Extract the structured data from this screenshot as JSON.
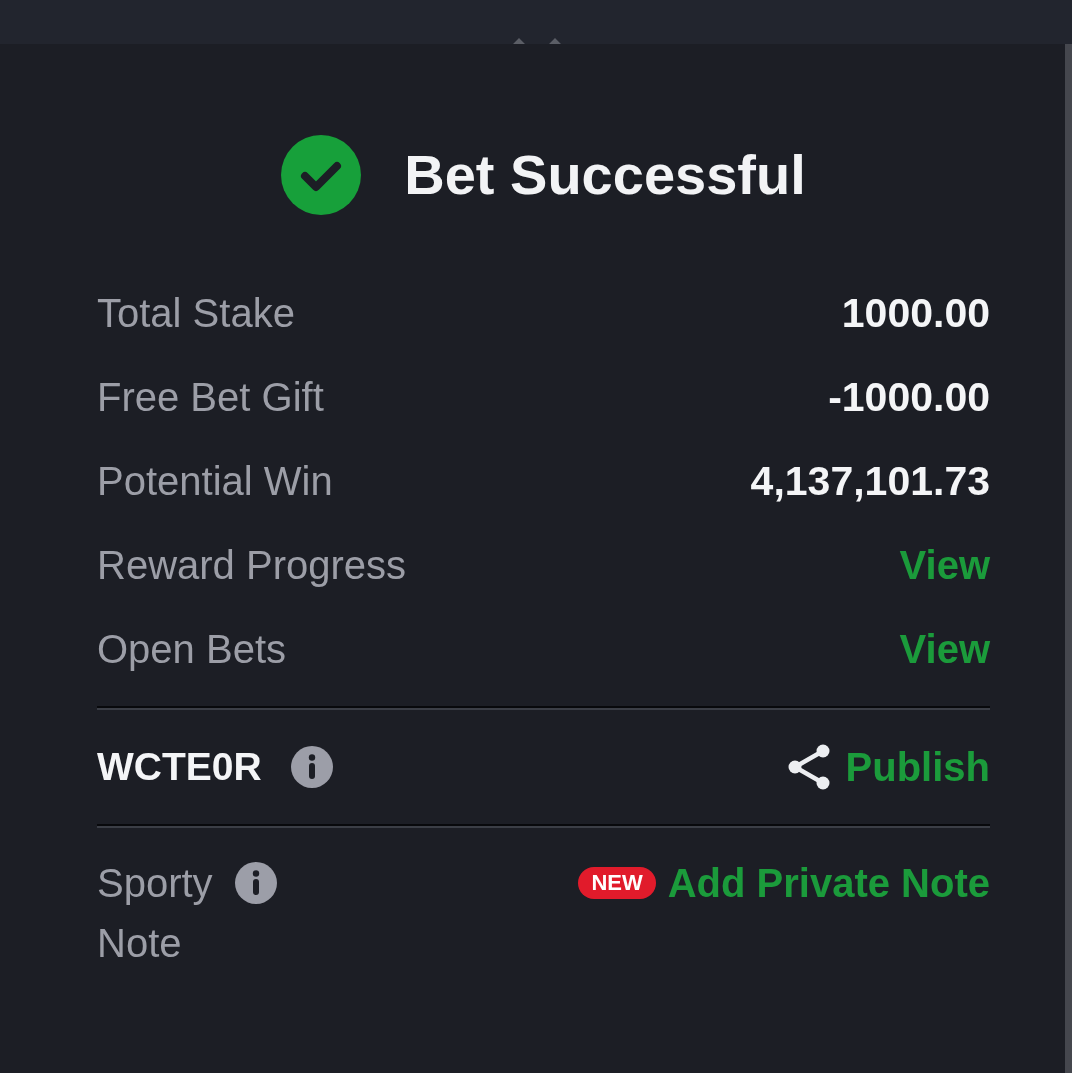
{
  "header": {
    "title": "Bet Successful"
  },
  "summary": [
    {
      "label": "Total Stake",
      "value": "1000.00",
      "kind": "amount"
    },
    {
      "label": "Free Bet Gift",
      "value": "-1000.00",
      "kind": "amount"
    },
    {
      "label": "Potential Win",
      "value": "4,137,101.73",
      "kind": "amount"
    },
    {
      "label": "Reward Progress",
      "value": "View",
      "kind": "link"
    },
    {
      "label": "Open Bets",
      "value": "View",
      "kind": "link"
    }
  ],
  "booking": {
    "code": "WCTE0R",
    "action": "Publish"
  },
  "note": {
    "label": "Sporty Note",
    "badge": "NEW",
    "action": "Add Private Note"
  }
}
